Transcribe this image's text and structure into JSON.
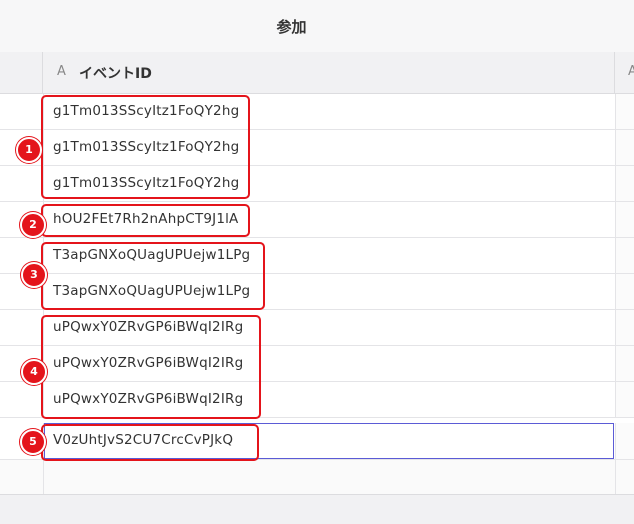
{
  "header": {
    "title": "参加"
  },
  "table": {
    "column": {
      "type_icon": "A",
      "name": "イベントID"
    },
    "next_column": {
      "type_icon": "A"
    },
    "rows": [
      "g1Tm013SScyItz1FoQY2hg",
      "g1Tm013SScyItz1FoQY2hg",
      "g1Tm013SScyItz1FoQY2hg",
      "hOU2FEt7Rh2nAhpCT9J1lA",
      "T3apGNXoQUagUPUejw1LPg",
      "T3apGNXoQUagUPUejw1LPg",
      "uPQwxY0ZRvGP6iBWqI2IRg",
      "uPQwxY0ZRvGP6iBWqI2IRg",
      "uPQwxY0ZRvGP6iBWqI2IRg",
      "V0zUhtJvS2CU7CrcCvPJkQ"
    ]
  },
  "annotations": {
    "markers": [
      "1",
      "2",
      "3",
      "4",
      "5"
    ],
    "color": "#e4141b"
  }
}
